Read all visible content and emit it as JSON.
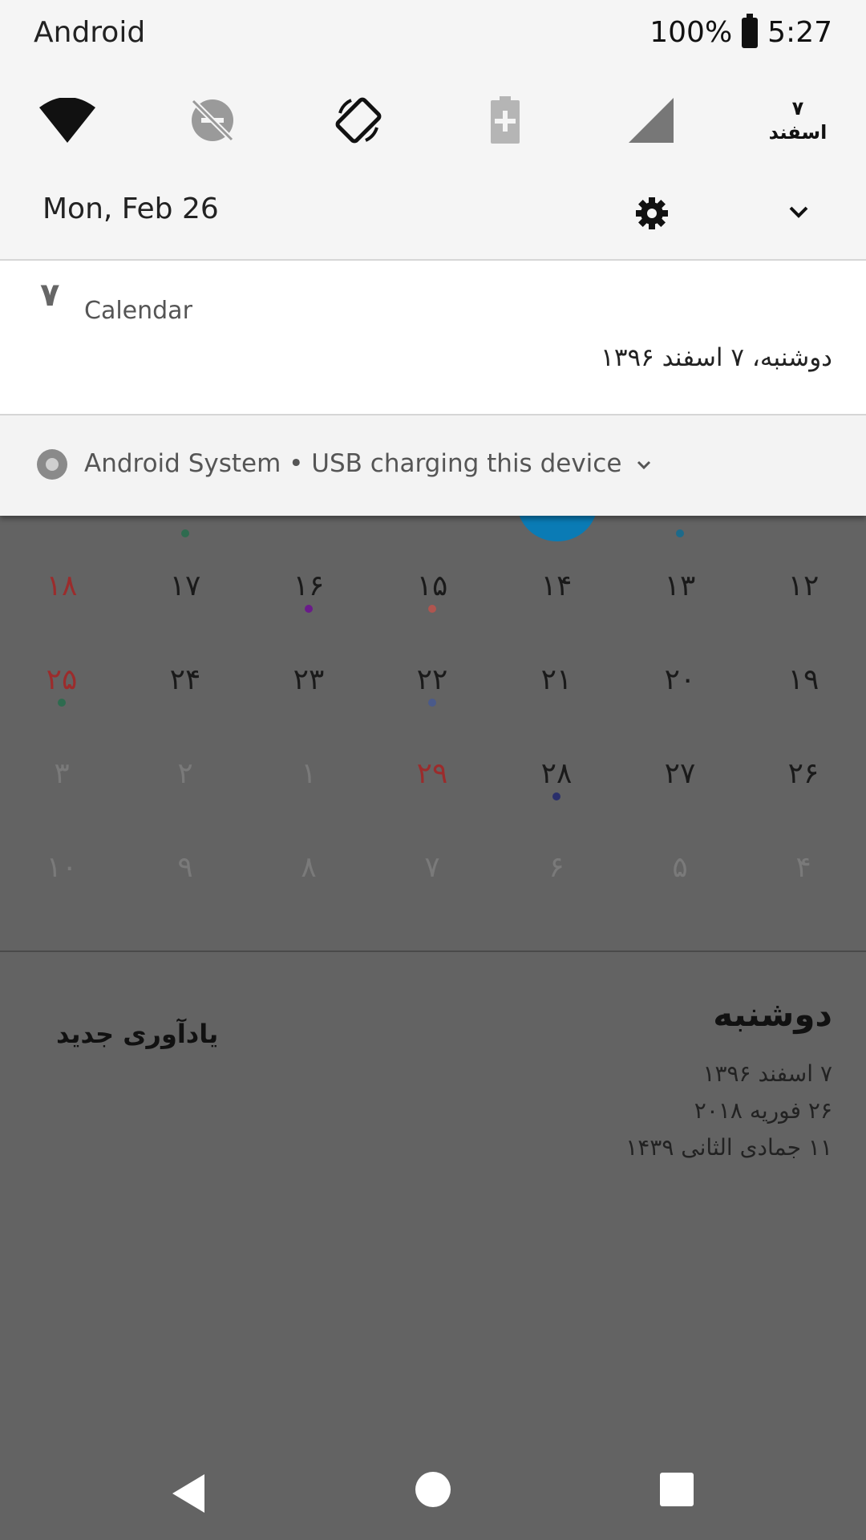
{
  "status_bar": {
    "carrier": "Android",
    "battery": "100%",
    "time": "5:27"
  },
  "quick_settings": {
    "date_tile_top": "۷",
    "date_tile_bottom": "اسفند"
  },
  "header": {
    "date": "Mon, Feb 26"
  },
  "calendar_notification": {
    "app_icon_glyph": "۷",
    "app_name": "Calendar",
    "text": "دوشنبه، ۷ اسفند ۱۳۹۶"
  },
  "system_notification": {
    "text": "Android System • USB charging this device"
  },
  "calendar_grid": {
    "rows": [
      [
        {
          "n": "۱۸",
          "style": "holiday",
          "dot": ""
        },
        {
          "n": "۱۷",
          "style": "",
          "dot": ""
        },
        {
          "n": "۱۶",
          "style": "",
          "dot": "#6a1b8a"
        },
        {
          "n": "۱۵",
          "style": "",
          "dot": "#b0554f"
        },
        {
          "n": "۱۴",
          "style": "",
          "dot": ""
        },
        {
          "n": "۱۳",
          "style": "",
          "dot": ""
        },
        {
          "n": "۱۲",
          "style": "",
          "dot": ""
        }
      ],
      [
        {
          "n": "۲۵",
          "style": "holiday",
          "dot": "#2e6b4f"
        },
        {
          "n": "۲۴",
          "style": "",
          "dot": ""
        },
        {
          "n": "۲۳",
          "style": "",
          "dot": ""
        },
        {
          "n": "۲۲",
          "style": "",
          "dot": "#4a5a8a"
        },
        {
          "n": "۲۱",
          "style": "",
          "dot": ""
        },
        {
          "n": "۲۰",
          "style": "",
          "dot": ""
        },
        {
          "n": "۱۹",
          "style": "",
          "dot": ""
        }
      ],
      [
        {
          "n": "۳",
          "style": "dim",
          "dot": ""
        },
        {
          "n": "۲",
          "style": "dim",
          "dot": ""
        },
        {
          "n": "۱",
          "style": "dim",
          "dot": ""
        },
        {
          "n": "۲۹",
          "style": "holiday",
          "dot": ""
        },
        {
          "n": "۲۸",
          "style": "",
          "dot": "#2a2f6b"
        },
        {
          "n": "۲۷",
          "style": "",
          "dot": ""
        },
        {
          "n": "۲۶",
          "style": "",
          "dot": ""
        }
      ],
      [
        {
          "n": "۱۰",
          "style": "dim",
          "dot": ""
        },
        {
          "n": "۹",
          "style": "dim",
          "dot": ""
        },
        {
          "n": "۸",
          "style": "dim",
          "dot": ""
        },
        {
          "n": "۷",
          "style": "dim",
          "dot": ""
        },
        {
          "n": "۶",
          "style": "dim",
          "dot": ""
        },
        {
          "n": "۵",
          "style": "dim",
          "dot": ""
        },
        {
          "n": "۴",
          "style": "dim",
          "dot": ""
        }
      ]
    ]
  },
  "day_info": {
    "day_name": "دوشنبه",
    "persian_date": "۷ اسفند ۱۳۹۶",
    "gregorian_date": "۲۶ فوریه ۲۰۱۸",
    "hijri_date": "۱۱ جمادی الثانی ۱۴۳۹"
  },
  "new_reminder": "یادآوری جدید",
  "colors": {
    "fab": "#0a7bb5",
    "holiday": "#9b2c2c",
    "shade_bg": "#f5f5f5"
  }
}
